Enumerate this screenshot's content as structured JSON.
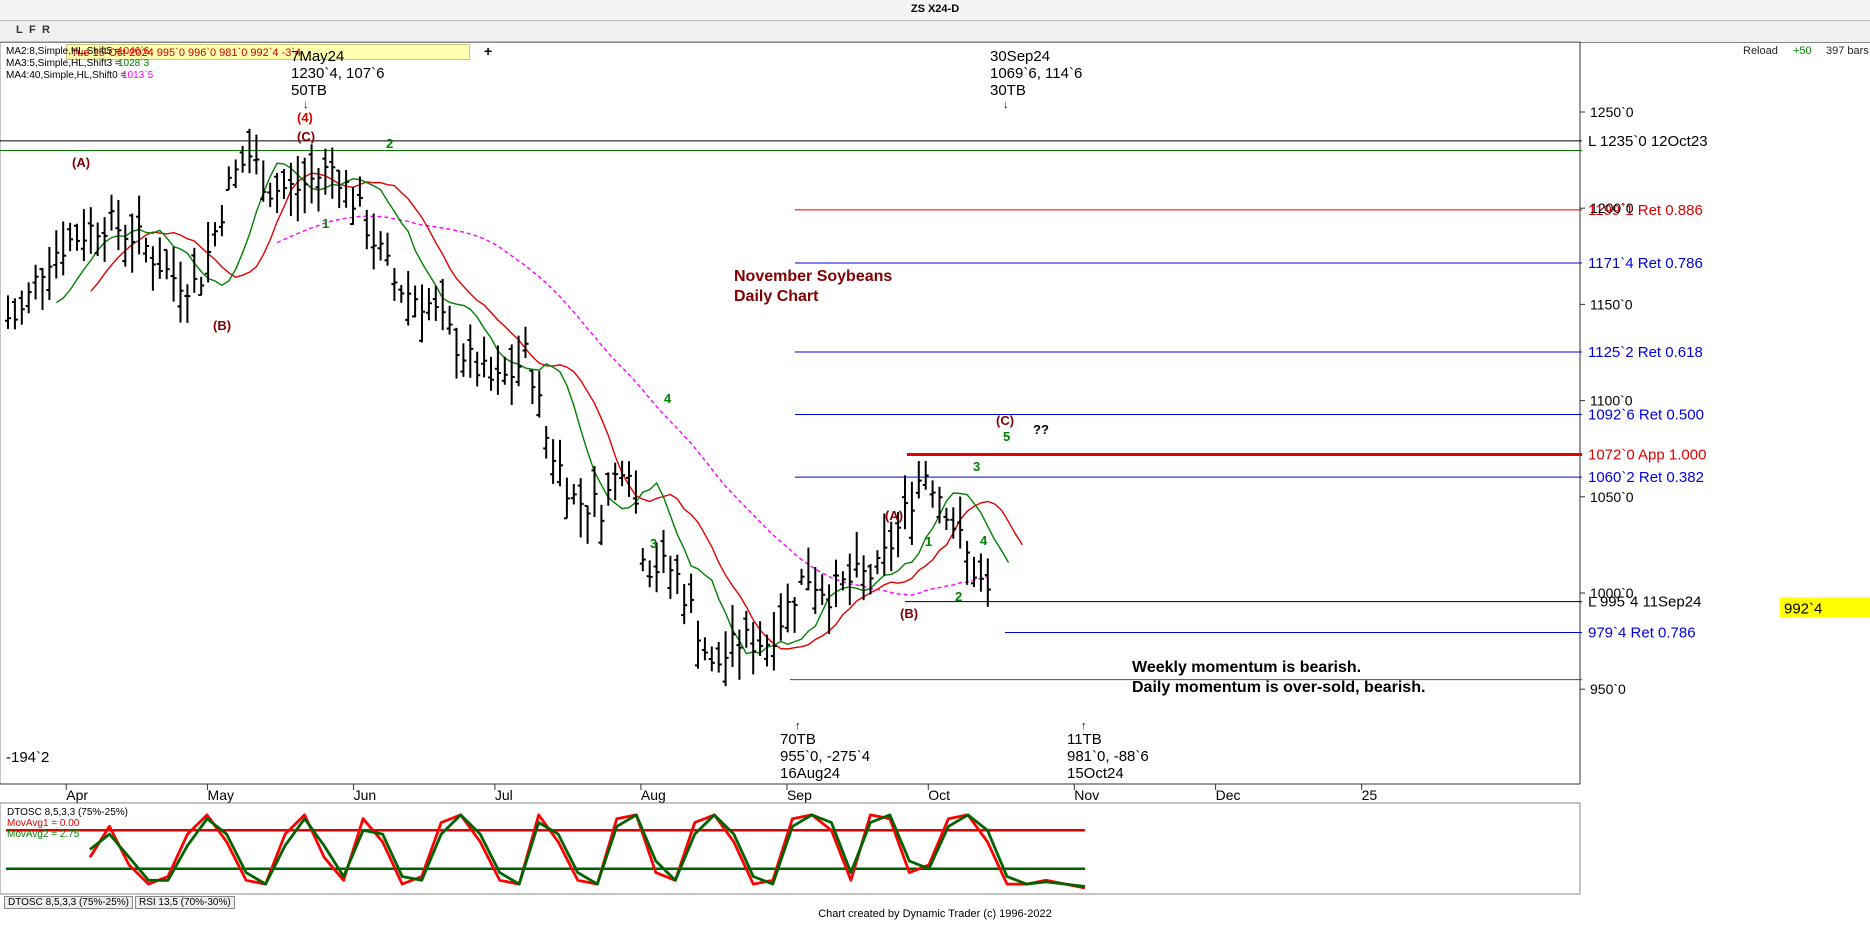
{
  "window": {
    "title": "ZS X24-D"
  },
  "toolbar": {
    "buttons": [
      "L",
      "F",
      "R"
    ],
    "quote": "Tue 15-Oct-2024   995`0   996`0   981`0   992`4   -3`4",
    "add": "+",
    "reload": "Reload",
    "reload_count": "+50",
    "bars": "397 bars"
  },
  "indicators": [
    {
      "label": "MA2:8,Simple,HL,Shift5 =",
      "value": "1046`6",
      "color": "#e00000"
    },
    {
      "label": "MA3:5,Simple,HL,Shift3 =",
      "value": "1028`3",
      "color": "#008000"
    },
    {
      "label": "MA4:40,Simple,HL,Shift0 =",
      "value": "1013`5",
      "color": "#ff00ff"
    }
  ],
  "chart_data": {
    "type": "ohlc",
    "title": "ZS X24-D",
    "subtitle": "November Soybeans\nDaily Chart",
    "y_axis": {
      "ticks": [
        "1250`0",
        "1200`0",
        "1150`0",
        "1100`0",
        "1050`0",
        "1000`0",
        "950`0"
      ],
      "values": [
        1250,
        1200,
        1150,
        1100,
        1050,
        1000,
        950
      ]
    },
    "x_axis": {
      "ticks": [
        "Apr",
        "May",
        "Jun",
        "Jul",
        "Aug",
        "Sep",
        "Oct",
        "Nov",
        "Dec",
        "25"
      ]
    },
    "last_price": "992`4",
    "price_path": [
      [
        "2024-03-22",
        1143
      ],
      [
        "2024-03-28",
        1175
      ],
      [
        "2024-04-03",
        1185
      ],
      [
        "2024-04-09",
        1193
      ],
      [
        "2024-04-16",
        1185
      ],
      [
        "2024-04-23",
        1165
      ],
      [
        "2024-04-29",
        1160
      ],
      [
        "2024-05-06",
        1215
      ],
      [
        "2024-05-10",
        1228
      ],
      [
        "2024-05-14",
        1210
      ],
      [
        "2024-05-20",
        1210
      ],
      [
        "2024-05-28",
        1222
      ],
      [
        "2024-06-03",
        1195
      ],
      [
        "2024-06-10",
        1160
      ],
      [
        "2024-06-17",
        1150
      ],
      [
        "2024-06-25",
        1122
      ],
      [
        "2024-07-01",
        1108
      ],
      [
        "2024-07-05",
        1115
      ],
      [
        "2024-07-08",
        1125
      ],
      [
        "2024-07-12",
        1080
      ],
      [
        "2024-07-18",
        1048
      ],
      [
        "2024-07-24",
        1045
      ],
      [
        "2024-07-29",
        1075
      ],
      [
        "2024-08-02",
        1015
      ],
      [
        "2024-08-08",
        1012
      ],
      [
        "2024-08-12",
        990
      ],
      [
        "2024-08-16",
        960
      ],
      [
        "2024-08-22",
        975
      ],
      [
        "2024-08-28",
        975
      ],
      [
        "2024-09-05",
        1010
      ],
      [
        "2024-09-10",
        1000
      ],
      [
        "2024-09-16",
        1008
      ],
      [
        "2024-09-20",
        1010
      ],
      [
        "2024-09-25",
        1035
      ],
      [
        "2024-09-30",
        1065
      ],
      [
        "2024-10-04",
        1050
      ],
      [
        "2024-10-09",
        1020
      ],
      [
        "2024-10-15",
        992
      ]
    ],
    "ma8": {
      "name": "MA2:8,Simple,HL,Shift5",
      "color": "#e00000",
      "value": "1046`6"
    },
    "ma5": {
      "name": "MA3:5,Simple,HL,Shift3",
      "color": "#008000",
      "value": "1028`3"
    },
    "ma40": {
      "name": "MA4:40,Simple,HL,Shift0",
      "color": "#ff00ff",
      "value": "1013`5"
    },
    "levels": [
      {
        "price": 1235,
        "label": "L 1235`0 12Oct23",
        "color": "#000000"
      },
      {
        "price": 1199.125,
        "label": "1199`1 Ret 0.886",
        "color": "#e00000"
      },
      {
        "price": 1171.5,
        "label": "1171`4 Ret 0.786",
        "color": "#0000e0"
      },
      {
        "price": 1125.25,
        "label": "1125`2 Ret 0.618",
        "color": "#0000e0"
      },
      {
        "price": 1092.75,
        "label": "1092`6 Ret 0.500",
        "color": "#0000e0"
      },
      {
        "price": 1072,
        "label": "1072`0 App 1.000",
        "color": "#e00000",
        "thick": true
      },
      {
        "price": 1060.25,
        "label": "1060`2 Ret 0.382",
        "color": "#0000e0"
      },
      {
        "price": 995.5,
        "label": "L 995`4 11Sep24",
        "color": "#000000"
      },
      {
        "price": 979.5,
        "label": "979`4 Ret 0.786",
        "color": "#0000e0"
      }
    ],
    "annotations": {
      "top_left": {
        "lines": [
          "7May24",
          "1230`4, 107`6",
          "50TB"
        ]
      },
      "top_mid": {
        "lines": [
          "30Sep24",
          "1069`6, 114`6",
          "30TB"
        ]
      },
      "bottom_low": {
        "lines": [
          "70TB",
          "955`0, -275`4",
          "16Aug24"
        ]
      },
      "bottom_last": {
        "lines": [
          "11TB",
          "981`0, -88`6",
          "15Oct24"
        ]
      },
      "left_value": "-194`2",
      "momentum": [
        "Weekly momentum is bearish.",
        "Daily momentum is over-sold, bearish."
      ],
      "waves": [
        {
          "t": "(A)",
          "c": "#800000"
        },
        {
          "t": "(B)",
          "c": "#800000"
        },
        {
          "t": "(4)",
          "c": "#e00000"
        },
        {
          "t": "(C)",
          "c": "#800000"
        },
        {
          "t": "1",
          "c": "#008000"
        },
        {
          "t": "2",
          "c": "#008000"
        },
        {
          "t": "3",
          "c": "#008000"
        },
        {
          "t": "4",
          "c": "#008000"
        },
        {
          "t": "(A)",
          "c": "#800000"
        },
        {
          "t": "(B)",
          "c": "#800000"
        },
        {
          "t": "1",
          "c": "#008000"
        },
        {
          "t": "2",
          "c": "#008000"
        },
        {
          "t": "3",
          "c": "#008000"
        },
        {
          "t": "4",
          "c": "#008000"
        },
        {
          "t": "5",
          "c": "#008000"
        },
        {
          "t": "(C)",
          "c": "#800000"
        },
        {
          "t": "??",
          "c": "#000000"
        }
      ]
    },
    "oscillator": {
      "name": "DTOSC 8,5,3,3 (75%-25%)",
      "mavg1": "MovAvg1 = 0.00",
      "mavg2": "MovAvg2 = 2.75",
      "upper": 75,
      "lower": 25,
      "fast": [
        40,
        80,
        30,
        5,
        15,
        70,
        95,
        60,
        10,
        5,
        70,
        95,
        40,
        10,
        90,
        60,
        5,
        15,
        85,
        95,
        60,
        10,
        5,
        95,
        60,
        10,
        5,
        90,
        95,
        20,
        10,
        85,
        95,
        60,
        5,
        10,
        90,
        95,
        75,
        10,
        95,
        90,
        20,
        30,
        90,
        95,
        60,
        5,
        5,
        10,
        5,
        0
      ],
      "slow": [
        50,
        70,
        40,
        10,
        10,
        55,
        90,
        70,
        20,
        5,
        55,
        90,
        55,
        15,
        75,
        70,
        15,
        10,
        70,
        95,
        70,
        20,
        5,
        85,
        70,
        20,
        5,
        80,
        95,
        35,
        10,
        70,
        95,
        70,
        15,
        5,
        80,
        95,
        85,
        20,
        85,
        95,
        35,
        25,
        80,
        95,
        75,
        15,
        5,
        8,
        5,
        2
      ]
    },
    "tabs": [
      "DTOSC 8,5,3,3 (75%-25%)",
      "RSI 13,5 (70%-30%)"
    ],
    "footer": "Chart created by Dynamic Trader  (c)  1996-2022"
  }
}
